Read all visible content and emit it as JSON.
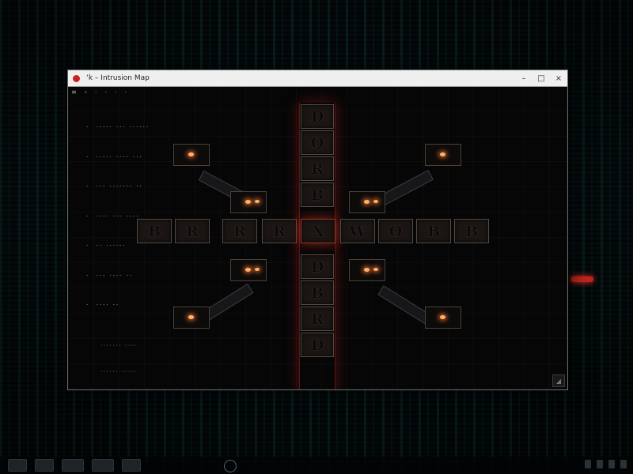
{
  "window": {
    "title": "‘k – Intrusion Map",
    "minimize": "–",
    "maximize": "□",
    "close": "×"
  },
  "toolbar": [
    "≡",
    "‹",
    "·",
    "·",
    "·",
    "·"
  ],
  "glyph_list": [
    "·  ·-··· ··· ···-··",
    "·  ··-·· ···· ···",
    "·  ··· ··-···· ··",
    "·  ···· ··· ·-··",
    "·  ·· ······",
    "·  ··· ···· ··",
    "·  ···· ··"
  ],
  "tiles": {
    "vertical": [
      "D",
      "Q",
      "R",
      "B",
      "X",
      "D",
      "B",
      "R",
      "D"
    ],
    "horizontal": [
      "B",
      "R",
      "R",
      "R",
      "X",
      "W",
      "O",
      "B",
      "B"
    ]
  },
  "log_lines": [
    "······· ····",
    "······ ·····",
    "········ ···",
    "····················",
    "···················",
    "···············"
  ],
  "colors": {
    "accent_red": "#cf1f1f",
    "glow_orange": "#ffb26a",
    "code_teal": "#2a7878"
  }
}
